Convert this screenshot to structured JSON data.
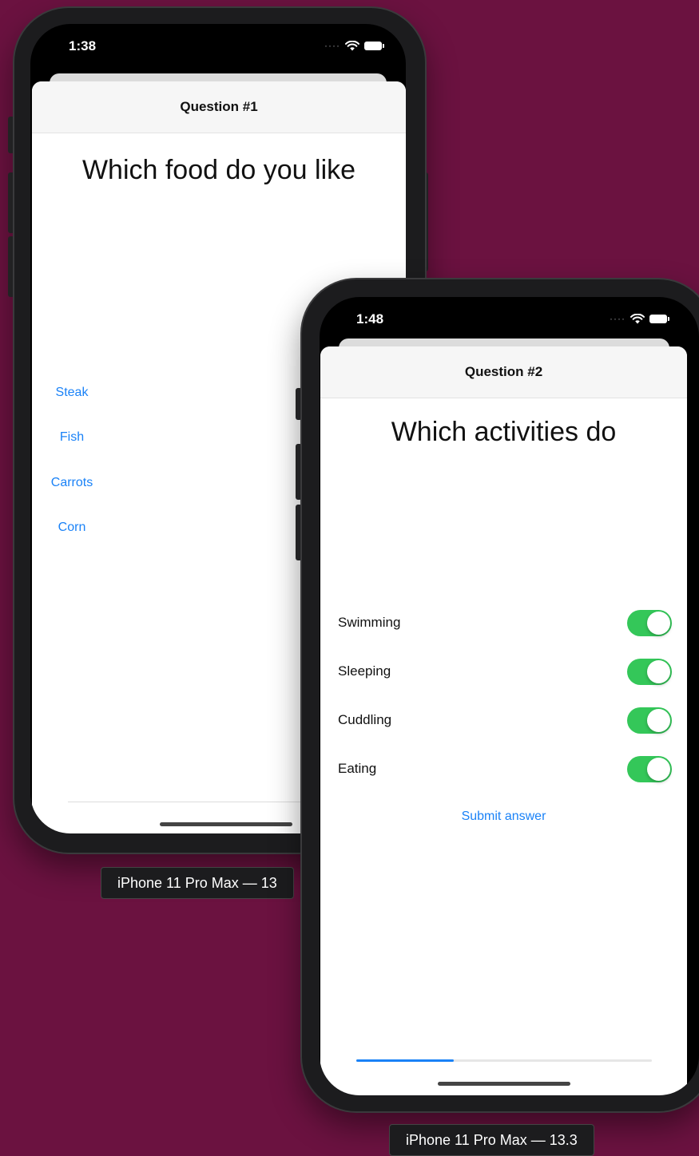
{
  "background_color": "#6b1240",
  "accent_color": "#1a82f7",
  "toggle_on_color": "#34c759",
  "devices": [
    {
      "status_time": "1:38",
      "nav_title": "Question #1",
      "question": "Which food do you like",
      "options": [
        "Steak",
        "Fish",
        "Carrots",
        "Corn"
      ],
      "label": "iPhone 11 Pro Max — 13"
    },
    {
      "status_time": "1:48",
      "nav_title": "Question #2",
      "question": "Which activities do",
      "activities": [
        {
          "label": "Swimming",
          "on": true
        },
        {
          "label": "Sleeping",
          "on": true
        },
        {
          "label": "Cuddling",
          "on": true
        },
        {
          "label": "Eating",
          "on": true
        }
      ],
      "submit_label": "Submit answer",
      "progress": 0.33,
      "label": "iPhone 11 Pro Max — 13.3"
    }
  ],
  "icons": {
    "signal": "signal-dots-icon",
    "wifi": "wifi-icon",
    "battery": "battery-icon"
  }
}
